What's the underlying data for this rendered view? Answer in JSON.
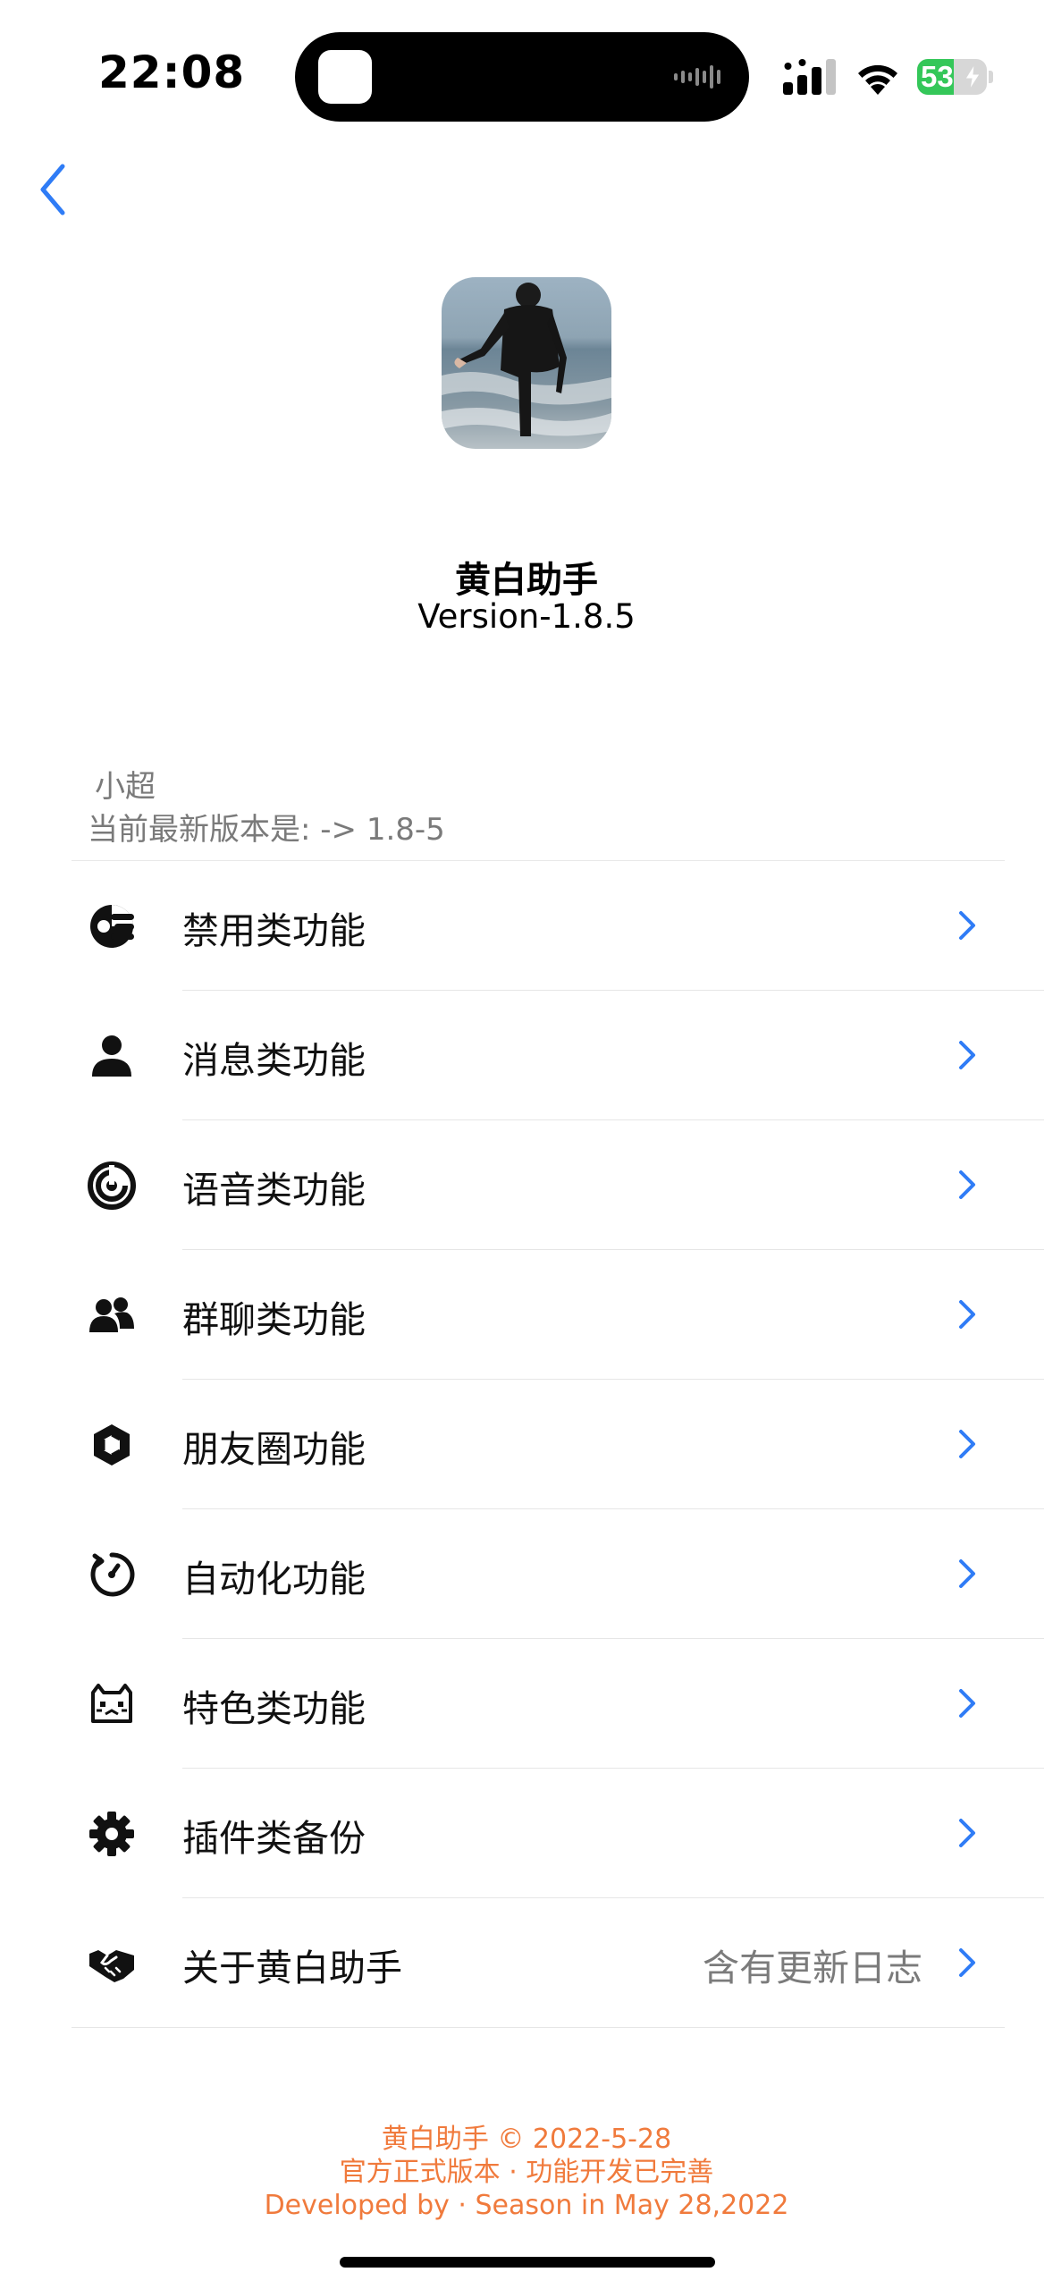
{
  "status_bar": {
    "time": "22:08",
    "battery_level": "53",
    "battery_fraction": 0.53,
    "battery_color": "#34c759"
  },
  "navigation": {
    "back_icon": "chevron-left-icon",
    "accent_color": "#2f7cf6"
  },
  "app": {
    "name": "黄白助手",
    "version": "Version-1.8.5"
  },
  "section": {
    "user": "小超",
    "latest_version": "当前最新版本是: -> 1.8-5"
  },
  "menu": [
    {
      "icon": "block-icon",
      "label": "禁用类功能",
      "detail": ""
    },
    {
      "icon": "person-icon",
      "label": "消息类功能",
      "detail": ""
    },
    {
      "icon": "voice-icon",
      "label": "语音类功能",
      "detail": ""
    },
    {
      "icon": "group-icon",
      "label": "群聊类功能",
      "detail": ""
    },
    {
      "icon": "aperture-icon",
      "label": "朋友圈功能",
      "detail": ""
    },
    {
      "icon": "timer-icon",
      "label": "自动化功能",
      "detail": ""
    },
    {
      "icon": "cat-icon",
      "label": "特色类功能",
      "detail": ""
    },
    {
      "icon": "gear-icon",
      "label": "插件类备份",
      "detail": ""
    },
    {
      "icon": "handshake-icon",
      "label": "关于黄白助手",
      "detail": "含有更新日志"
    }
  ],
  "footer": {
    "line1": "黄白助手 © 2022-5-28",
    "line2": "官方正式版本 · 功能开发已完善",
    "line3": "Developed by · Season in May 28,2022",
    "color": "#f07a3c"
  }
}
